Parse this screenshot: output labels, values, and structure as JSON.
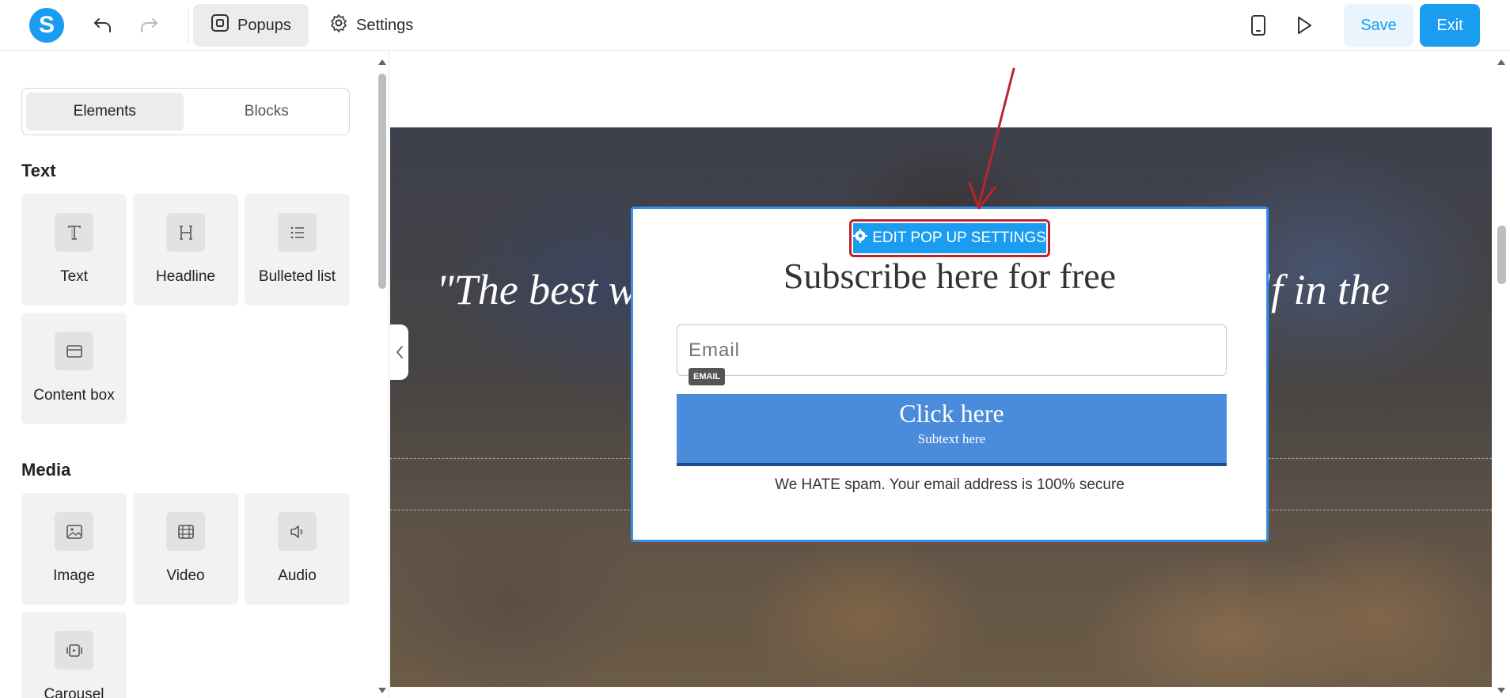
{
  "toolbar": {
    "logo_letter": "S",
    "popups_label": "Popups",
    "settings_label": "Settings",
    "save_label": "Save",
    "exit_label": "Exit"
  },
  "left_panel": {
    "tabs": [
      "Elements",
      "Blocks"
    ],
    "active_tab": "Elements",
    "sections": [
      {
        "title": "Text",
        "items": [
          "Text",
          "Headline",
          "Bulleted list",
          "Content box"
        ]
      },
      {
        "title": "Media",
        "items": [
          "Image",
          "Video",
          "Audio",
          "Carousel"
        ]
      }
    ]
  },
  "canvas": {
    "quote_left": "\"The best w",
    "quote_right": "elf in the",
    "edit_popup_label": "EDIT POP UP SETTINGS",
    "popup": {
      "title": "Subscribe here for free",
      "email_placeholder": "Email",
      "email_badge": "EMAIL",
      "cta_main": "Click here",
      "cta_sub": "Subtext here",
      "spam_note": "We HATE spam. Your email address is 100% secure"
    }
  },
  "colors": {
    "accent": "#1a9cf0",
    "highlight_annotation": "#b9252f",
    "cta_button": "#4a8cdb"
  }
}
